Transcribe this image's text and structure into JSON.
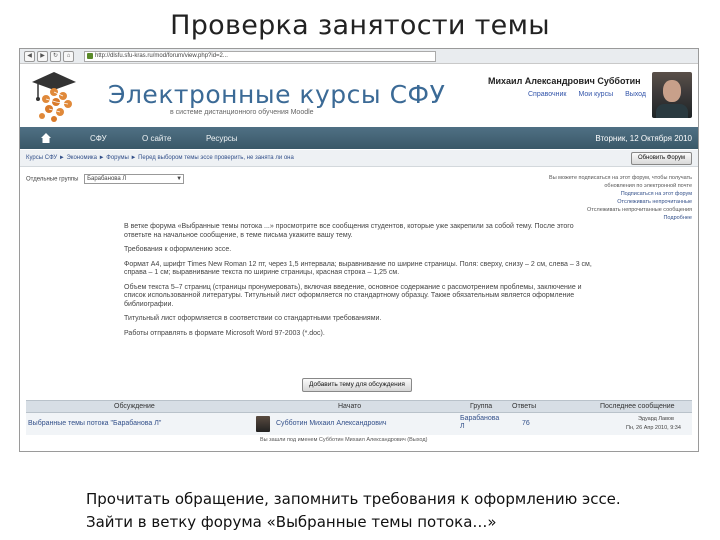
{
  "slide": {
    "title": "Проверка занятости темы",
    "caption_line1": "Прочитать обращение, запомнить требования к оформлению эссе.",
    "caption_line2": "Зайти в ветку форума «Выбранные темы потока…»"
  },
  "browser": {
    "url": "http://dlsfu.sfu-kras.ru/mod/forum/view.php?id=2..."
  },
  "header": {
    "site_title": "Электронные курсы СФУ",
    "site_subtitle": "в системе дистанционного обучения Moodle",
    "user_name": "Михаил Александрович Субботин",
    "user_links": [
      "Справочник",
      "Мои курсы",
      "Выход"
    ]
  },
  "navbar": {
    "items": [
      "СФУ",
      "О сайте",
      "Ресурсы"
    ],
    "date": "Вторник, 12 Октября 2010"
  },
  "breadcrumb": {
    "text": "Курсы СФУ ► Экономика ► Форумы ► Перед выбором темы эссе проверить, не занята ли она",
    "update_button": "Обновить Форум"
  },
  "groups": {
    "label": "Отдельные группы",
    "selected": "Барабанова Л"
  },
  "side_info": {
    "line1": "Вы можете подписаться на этот форум, чтобы получать",
    "line2": "обновления по электронной почте",
    "link1": "Подписаться на этот форум",
    "link2": "Отслеживать непрочитанные",
    "line3": "Отслеживать непрочитанные сообщения",
    "link3": "Подробнее"
  },
  "intro": {
    "p1": "В ветке форума «Выбранные темы потока ...» просмотрите все сообщения студентов, которые уже закрепили за собой тему. После этого ответьте на начальное сообщение, в теме письма укажите вашу тему.",
    "p2": "Требования к оформлению эссе.",
    "p3": "Формат А4, шрифт Times New Roman 12 пт, через 1,5 интервала; выравнивание по ширине страницы. Поля: сверху, снизу – 2 см, слева – 3 см, справа – 1 см; выравнивание текста по ширине страницы, красная строка – 1,25 см.",
    "p4": "Объем текста 5–7 страниц (страницы пронумеровать), включая введение, основное содержание с рассмотрением проблемы, заключение и список использованной литературы. Титульный лист оформляется по стандартному образцу. Также обязательным является оформление библиографии.",
    "p5": "Титульный лист оформляется в соответствии со стандартными требованиями.",
    "p6": "Работы отправлять в формате Microsoft Word 97-2003 (*.doc)."
  },
  "add_button": "Добавить тему для обсуждения",
  "table": {
    "headers": [
      "Обсуждение",
      "Начато",
      "Группа",
      "Ответы",
      "Последнее сообщение"
    ],
    "rows": [
      {
        "discussion": "Выбранные темы потока \"Барабанова Л\"",
        "started_by": "Субботин Михаил Александрович",
        "group": "Барабанова Л",
        "replies": "76",
        "last_post_user": "Эдуард Лавов",
        "last_post_date": "Пн, 26 Апр 2010, 9:34"
      }
    ]
  },
  "footer_note": "Вы зашли под именем Субботин Михаил Александрович (Выход)"
}
